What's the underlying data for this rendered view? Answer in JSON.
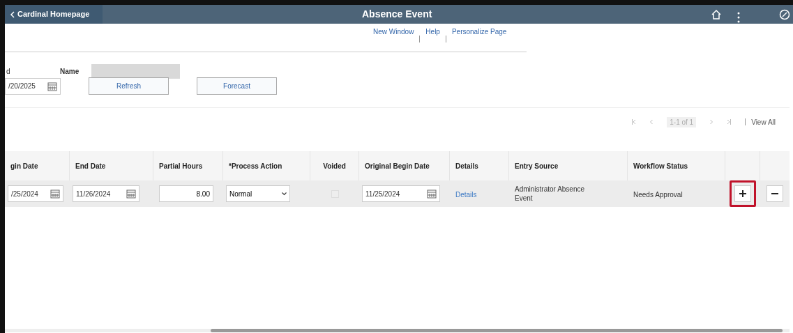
{
  "header": {
    "back_label": "Cardinal Homepage",
    "title": "Absence Event"
  },
  "links": [
    "New Window",
    "Help",
    "Personalize Page"
  ],
  "form": {
    "id_label": "d",
    "name_label": "Name",
    "date_value": "/20/2025",
    "buttons": [
      "Refresh",
      "Forecast"
    ]
  },
  "pagination": {
    "range": "1-1 of 1",
    "view_all": "View All"
  },
  "table": {
    "columns": [
      "gin Date",
      "End Date",
      "Partial Hours",
      "*Process Action",
      "Voided",
      "Original Begin Date",
      "Details",
      "Entry Source",
      "Workflow Status"
    ],
    "rows": [
      {
        "begin_date": "/25/2024",
        "end_date": "11/26/2024",
        "partial_hours": "8.00",
        "process_action": "Normal",
        "voided": {
          "checked": false,
          "disabled": true
        },
        "original_begin_date": "11/25/2024",
        "details": "Details",
        "entry_source": "Administrator Absence Event",
        "workflow_status": "Needs Approval",
        "add_highlighted": true
      }
    ]
  }
}
